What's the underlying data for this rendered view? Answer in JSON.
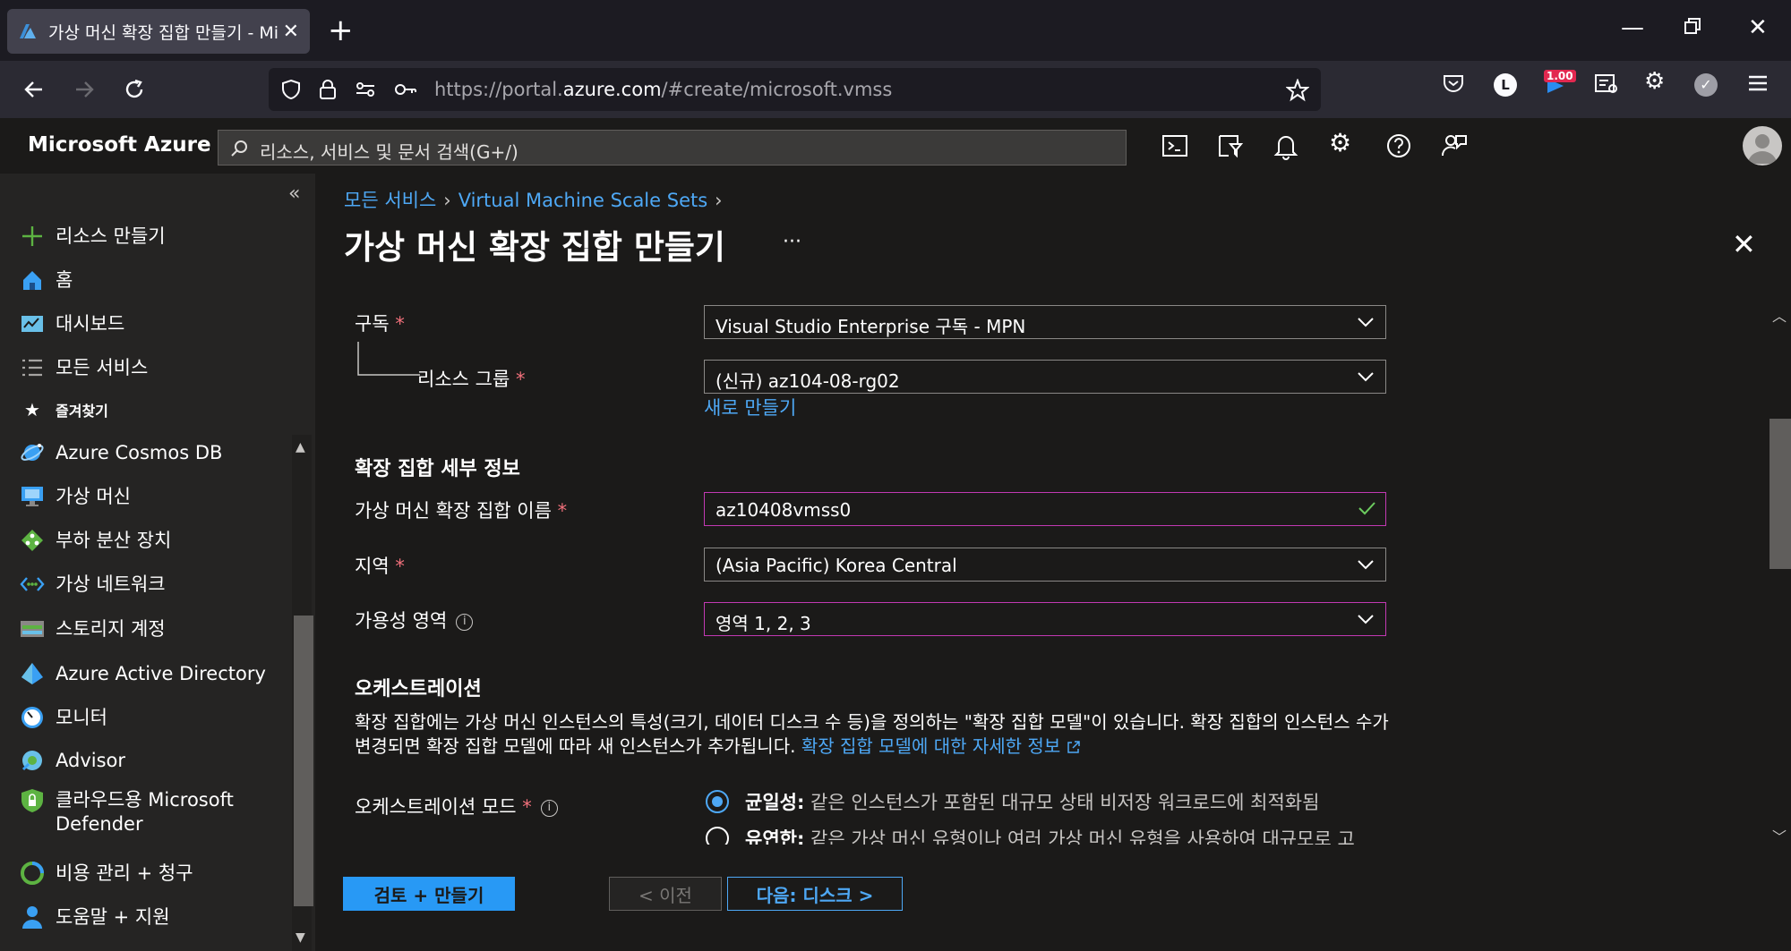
{
  "browser": {
    "tab_title": "가상 머신 확장 집합 만들기 - Mi",
    "url_prefix": "https://portal.",
    "url_domain": "azure.com",
    "url_path": "/#create/microsoft.vmss",
    "badge": "1.00",
    "profile_letter": "L"
  },
  "azure": {
    "brand": "Microsoft Azure",
    "search_placeholder": "리소스, 서비스 및 문서 검색(G+/)"
  },
  "sidebar": {
    "create": "리소스 만들기",
    "items": [
      {
        "label": "홈"
      },
      {
        "label": "대시보드"
      },
      {
        "label": "모든 서비스"
      }
    ],
    "favorites_label": "즐겨찾기",
    "favorites": [
      {
        "label": "Azure Cosmos DB"
      },
      {
        "label": "가상 머신"
      },
      {
        "label": "부하 분산 장치"
      },
      {
        "label": "가상 네트워크"
      },
      {
        "label": "스토리지 계정"
      },
      {
        "label": "Azure Active Directory"
      },
      {
        "label": "모니터"
      },
      {
        "label": "Advisor"
      },
      {
        "label": "클라우드용 Microsoft Defender"
      },
      {
        "label": "비용 관리 + 청구"
      },
      {
        "label": "도움말 + 지원"
      }
    ]
  },
  "breadcrumb": [
    "모든 서비스",
    "Virtual Machine Scale Sets"
  ],
  "page_title": "가상 머신 확장 집합 만들기",
  "ellipsis": "···",
  "form": {
    "subscription_label": "구독",
    "subscription_value": "Visual Studio Enterprise 구독 - MPN",
    "rg_label": "리소스 그룹",
    "rg_value": "(신규) az104-08-rg02",
    "rg_new_link": "새로 만들기",
    "details_heading": "확장 집합 세부 정보",
    "name_label": "가상 머신 확장 집합 이름",
    "name_value": "az10408vmss0",
    "region_label": "지역",
    "region_value": "(Asia Pacific) Korea Central",
    "az_label": "가용성 영역",
    "az_value": "영역 1, 2, 3",
    "orch_heading": "오케스트레이션",
    "orch_desc": "확장 집합에는 가상 머신 인스턴스의 특성(크기, 데이터 디스크 수 등)을 정의하는 \"확장 집합 모델\"이 있습니다. 확장 집합의 인스턴스 수가 변경되면 확장 집합 모델에 따라 새 인스턴스가 추가됩니다. ",
    "orch_link": "확장 집합 모델에 대한 자세한 정보",
    "orch_mode_label": "오케스트레이션 모드",
    "opt1_title": "균일성:",
    "opt1_desc": "같은 인스턴스가 포함된 대규모 상태 비저장 워크로드에 최적화됨",
    "opt2_title": "유연한:",
    "opt2_desc": "같은 가상 머신 유형이나 여러 가상 머신 유형을 사용하여 대규모로 고"
  },
  "footer": {
    "review": "검토 + 만들기",
    "prev": "< 이전",
    "next": "다음: 디스크 >"
  },
  "colors": {
    "accent": "#4ea8f5",
    "primary_button": "#2899f5",
    "required": "#f1707b",
    "focus_border": "#c239b3",
    "valid_check": "#6ccb5f"
  }
}
